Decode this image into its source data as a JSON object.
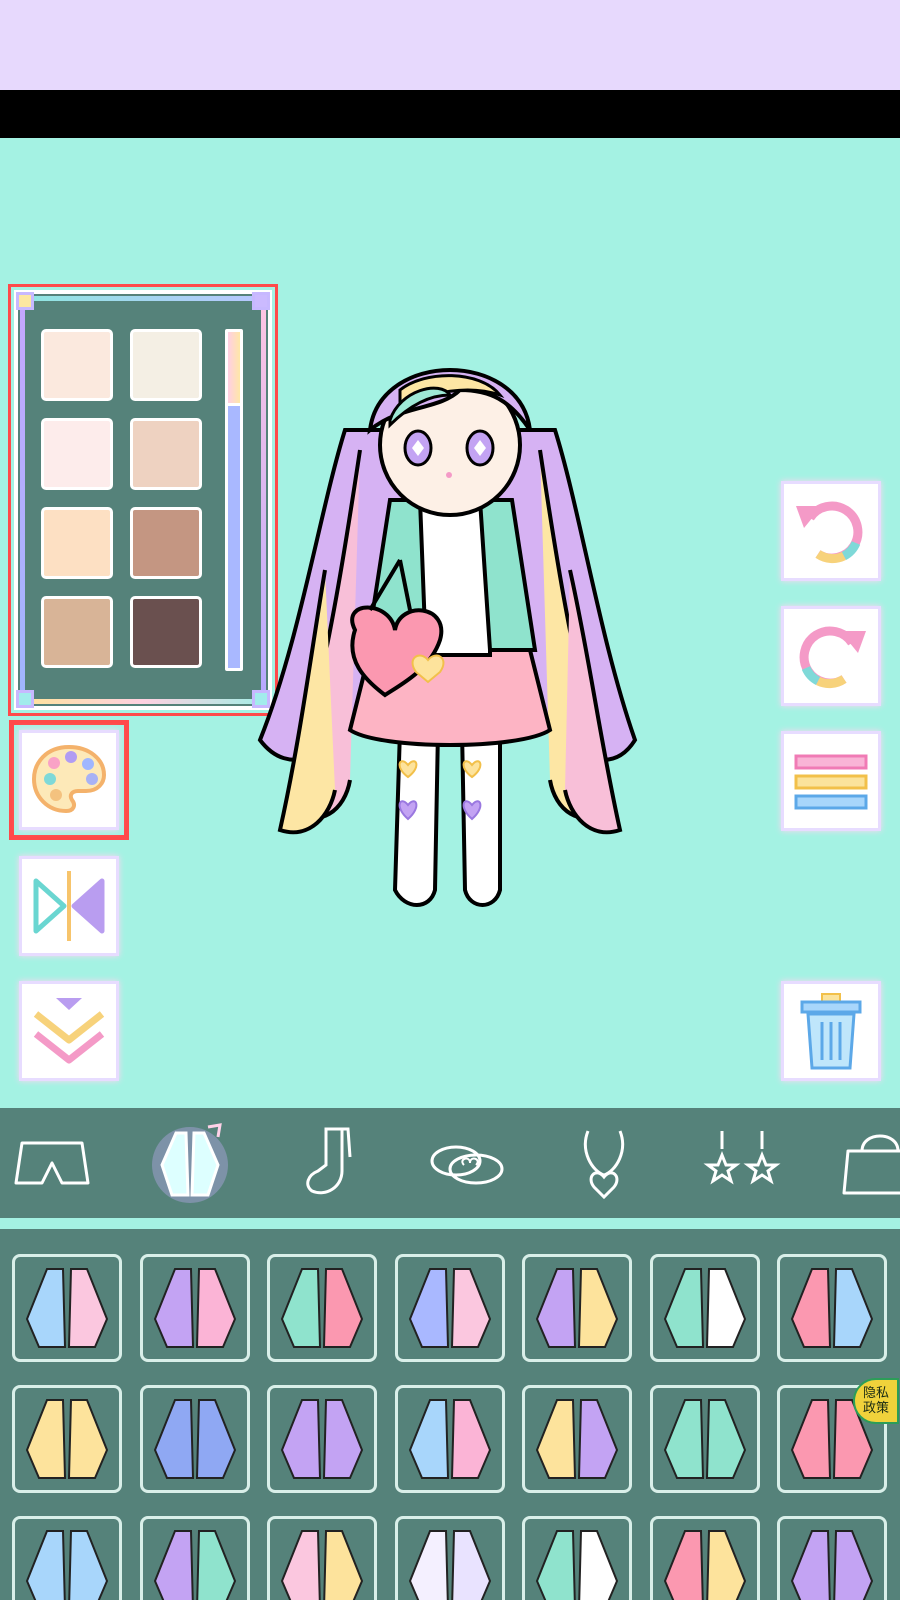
{
  "colors": {
    "top_band": "#e7d9fd",
    "stage_background": "#a4f2e3",
    "panel_dark": "#55827a",
    "highlight_outline": "#ff4a4a"
  },
  "skin_palette": {
    "swatches": [
      "#fbe9de",
      "#f4efe4",
      "#fdeceb",
      "#eed2c1",
      "#fde0c3",
      "#c49682",
      "#d8b497",
      "#6a504f"
    ],
    "selected_index": 0,
    "slider_level": 0.22
  },
  "left_buttons": [
    {
      "icon": "color-palette-icon",
      "highlighted": true
    },
    {
      "icon": "flip-horizontal-icon"
    },
    {
      "icon": "chevron-down-icon"
    }
  ],
  "right_buttons": [
    {
      "icon": "undo-icon"
    },
    {
      "icon": "redo-icon"
    },
    {
      "icon": "menu-icon"
    },
    {
      "icon": "trash-icon"
    }
  ],
  "categories": [
    {
      "icon": "shorts-icon"
    },
    {
      "icon": "jacket-icon",
      "active": true
    },
    {
      "icon": "socks-icon"
    },
    {
      "icon": "shoes-icon"
    },
    {
      "icon": "necklace-icon"
    },
    {
      "icon": "earrings-icon"
    },
    {
      "icon": "handbag-icon"
    }
  ],
  "items": [
    {
      "icon": "jacket-with-bag-icon"
    },
    {
      "icon": "pastel-hoodie-icon"
    },
    {
      "icon": "heart-bag-jacket-icon"
    },
    {
      "icon": "ribbon-cape-icon"
    },
    {
      "icon": "varsity-jacket-icon"
    },
    {
      "icon": "bunny-charm-icon"
    },
    {
      "icon": "star-bag-icon"
    },
    {
      "icon": "yellow-cardigan-icon"
    },
    {
      "icon": "denim-jacket-icon"
    },
    {
      "icon": "purple-coat-icon"
    },
    {
      "icon": "cat-track-jacket-icon"
    },
    {
      "icon": "yellow-hoodie-icon"
    },
    {
      "icon": "mint-shirt-icon"
    },
    {
      "icon": "pink-duffle-coat-icon"
    },
    {
      "icon": "blue-duffle-coat-icon"
    },
    {
      "icon": "purple-hoodie-icon"
    },
    {
      "icon": "pink-yellow-hoodie-icon"
    },
    {
      "icon": "white-puffer-icon"
    },
    {
      "icon": "mint-varsity-icon"
    },
    {
      "icon": "pink-coat-icon"
    },
    {
      "icon": "purple-sweater-icon"
    }
  ],
  "privacy_badge": {
    "line1": "隐私",
    "line2": "政策"
  }
}
